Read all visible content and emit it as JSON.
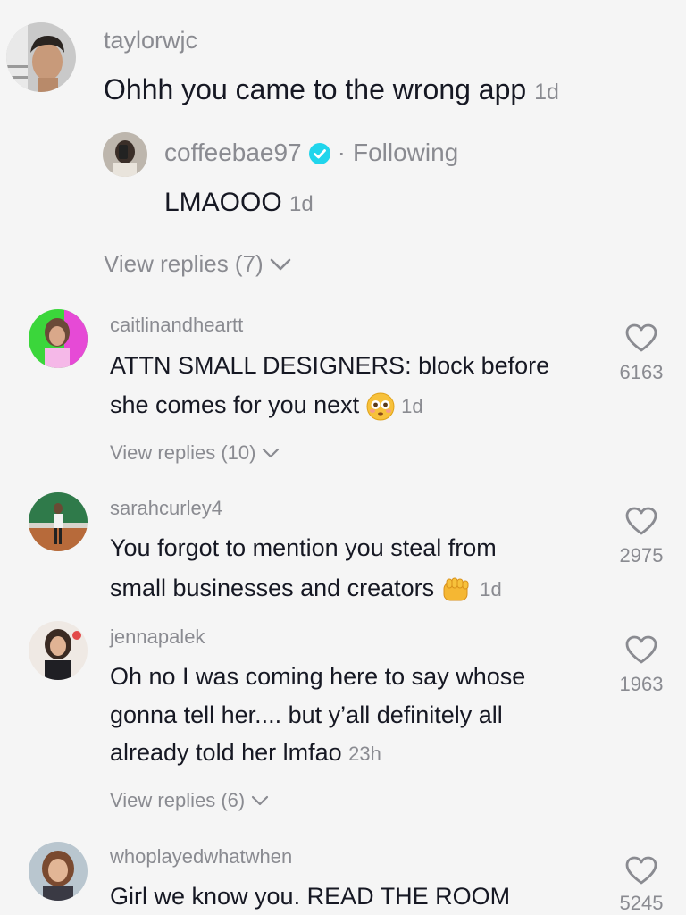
{
  "comments_thread": {
    "top_comment": {
      "username": "taylorwjc",
      "text": "Ohhh you came to the wrong app",
      "time": "1d"
    },
    "reply": {
      "username": "coffeebae97",
      "verified_icon": "verified-check-icon",
      "separator": "·",
      "following_label": "Following",
      "text": "LMAOOO",
      "time": "1d"
    },
    "view_replies_label": "View replies (7)"
  },
  "comments": [
    {
      "username": "caitlinandheartt",
      "line1": "ATTN SMALL DESIGNERS: block before",
      "line2": "she comes for you next",
      "emoji": "flushed-face-emoji",
      "time": "1d",
      "likes": "6163",
      "view_replies_label": "View replies (10)"
    },
    {
      "username": "sarahcurley4",
      "line1": "You forgot to mention you steal from",
      "line2": "small businesses and creators",
      "emoji": "fist-emoji",
      "time": "1d",
      "likes": "2975"
    },
    {
      "username": "jennapalek",
      "line1": "Oh no I was coming here to say whose",
      "line2": "gonna tell her.... but y’all definitely all",
      "line3": "already told her lmfao",
      "time": "23h",
      "likes": "1963",
      "view_replies_label": "View replies (6)"
    },
    {
      "username": "whoplayedwhatwhen",
      "line1": "Girl we know you. READ THE ROOM",
      "likes": "5245"
    }
  ],
  "colors": {
    "background": "#f5f5f5",
    "primary_text": "#161823",
    "secondary_text": "#8a8b91",
    "verified_blue": "#20d5ec"
  }
}
